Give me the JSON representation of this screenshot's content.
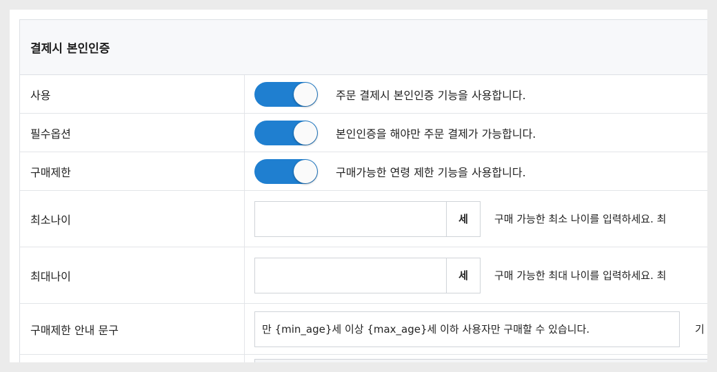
{
  "section": {
    "title": "결제시 본인인증"
  },
  "rows": {
    "use": {
      "label": "사용",
      "toggle_on": true,
      "desc": "주문 결제시 본인인증 기능을 사용합니다."
    },
    "required": {
      "label": "필수옵션",
      "toggle_on": true,
      "desc": "본인인증을 해야만 주문 결제가 가능합니다."
    },
    "restrict": {
      "label": "구매제한",
      "toggle_on": true,
      "desc": "구매가능한 연령 제한 기능을 사용합니다."
    },
    "min_age": {
      "label": "최소나이",
      "value": "",
      "unit": "세",
      "desc": "구매 가능한 최소 나이를 입력하세요. 최"
    },
    "max_age": {
      "label": "최대나이",
      "value": "",
      "unit": "세",
      "desc": "구매 가능한 최대 나이를 입력하세요. 최"
    },
    "notice": {
      "label": "구매제한 안내 문구",
      "value": "만 {min_age}세 이상 {max_age}세 이하 사용자만 구매할 수 있습니다.",
      "desc": "기"
    }
  },
  "colors": {
    "toggle_on": "#1f7fd0",
    "header_bg": "#f7f8fa"
  }
}
